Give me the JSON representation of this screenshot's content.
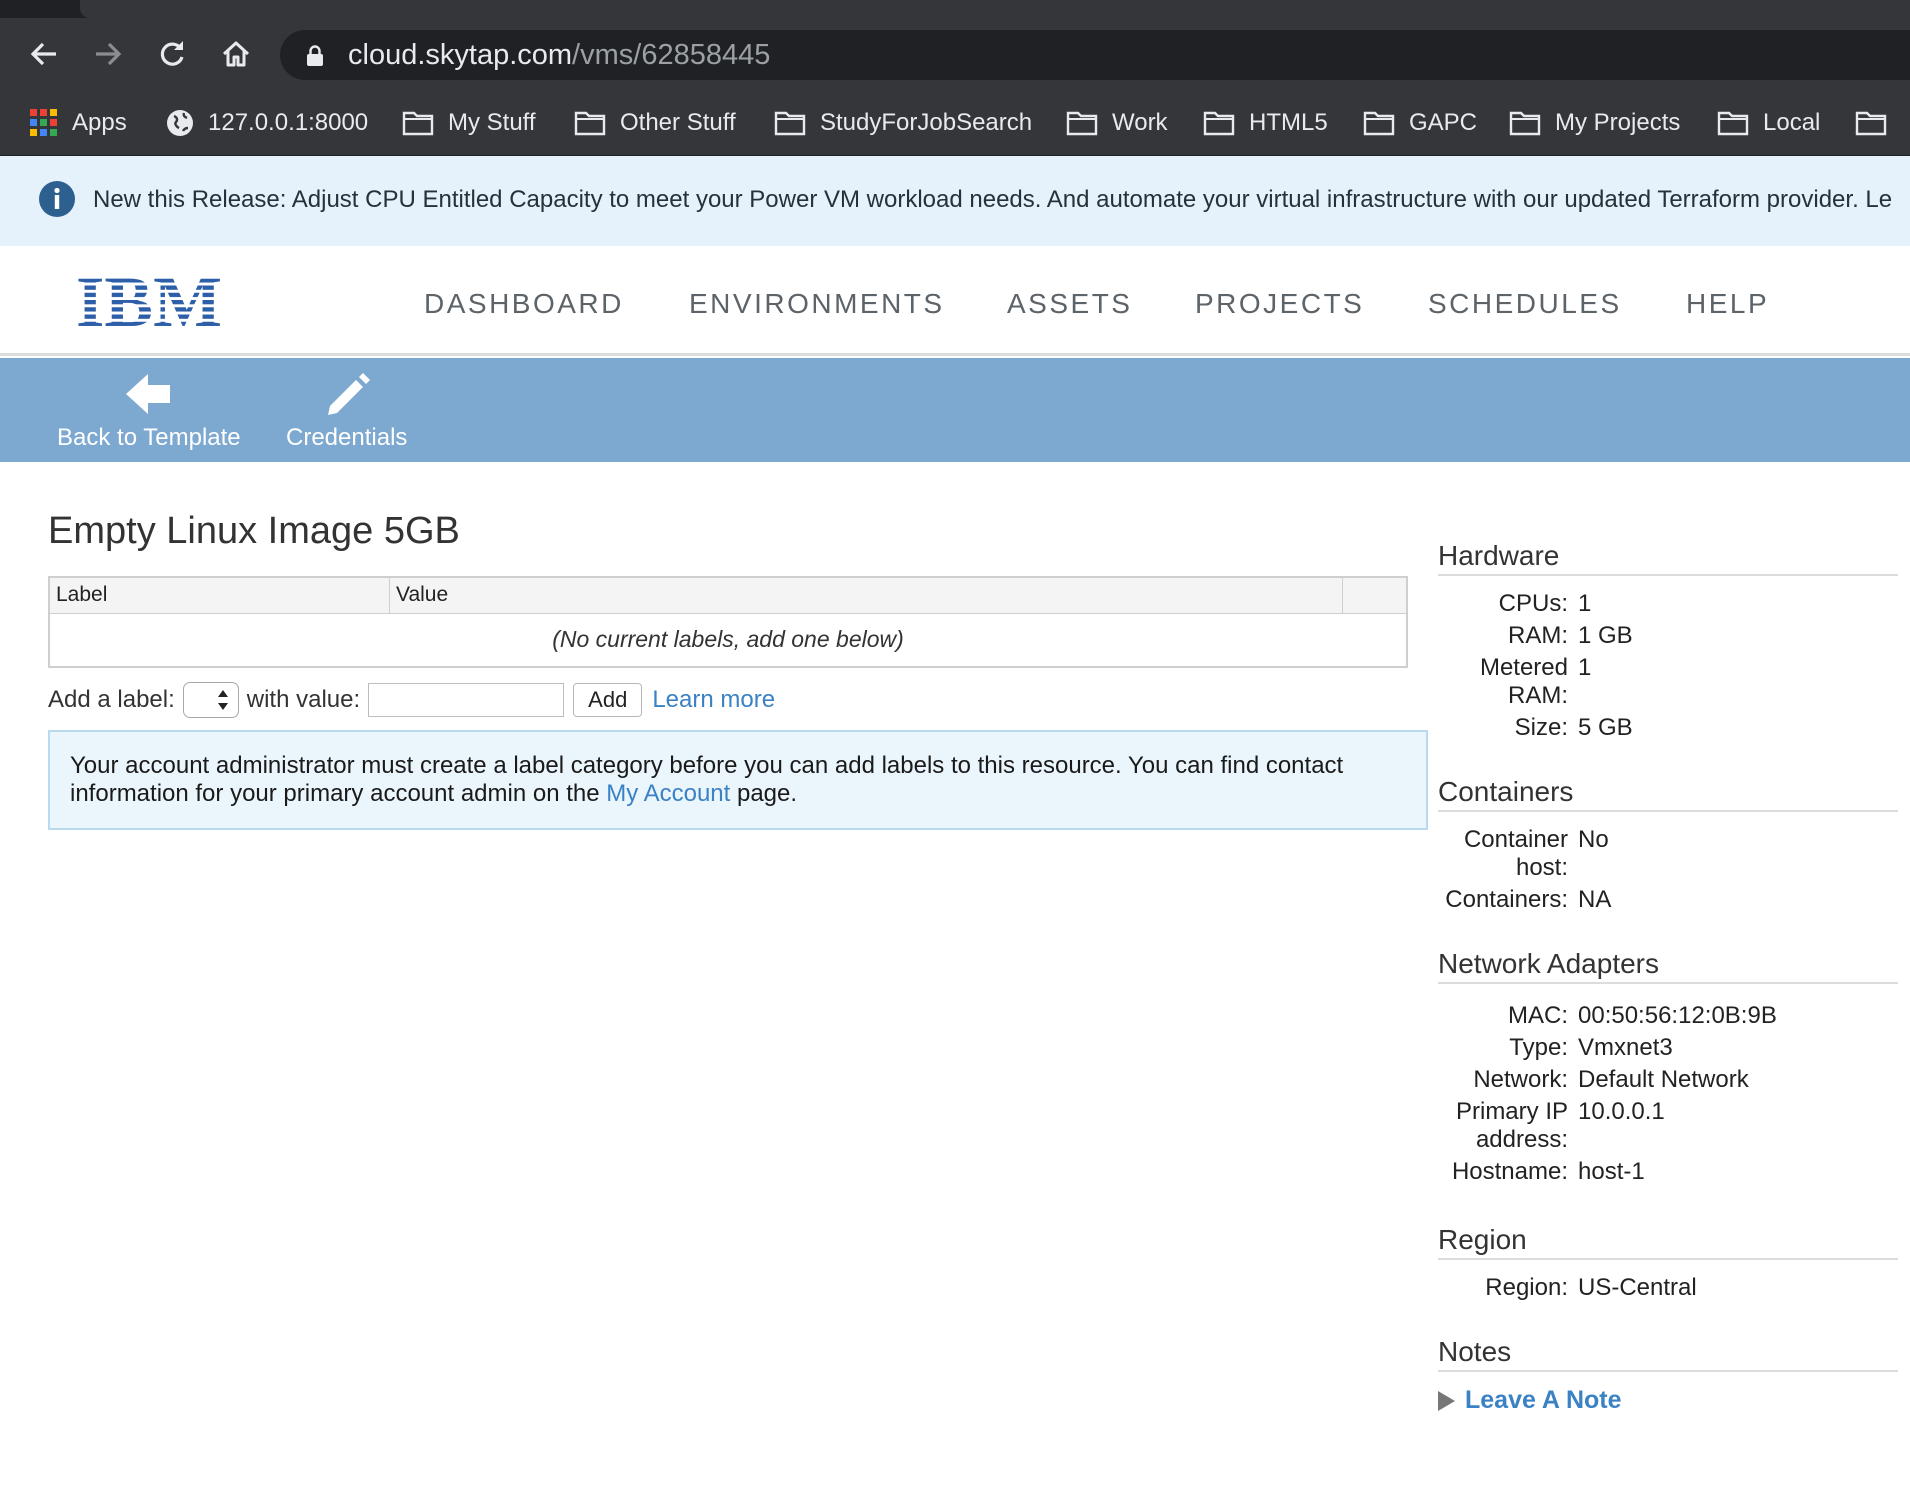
{
  "browser": {
    "url_host": "cloud.skytap.com",
    "url_path": "/vms/62858445",
    "bookmarks": [
      {
        "label": "Apps",
        "icon": "apps-grid-icon"
      },
      {
        "label": "127.0.0.1:8000",
        "icon": "globe-icon"
      },
      {
        "label": "My Stuff",
        "icon": "folder-icon"
      },
      {
        "label": "Other Stuff",
        "icon": "folder-icon"
      },
      {
        "label": "StudyForJobSearch",
        "icon": "folder-icon"
      },
      {
        "label": "Work",
        "icon": "folder-icon"
      },
      {
        "label": "HTML5",
        "icon": "folder-icon"
      },
      {
        "label": "GAPC",
        "icon": "folder-icon"
      },
      {
        "label": "My Projects",
        "icon": "folder-icon"
      },
      {
        "label": "Local",
        "icon": "folder-icon"
      }
    ]
  },
  "banner": {
    "text": "New this Release: Adjust CPU Entitled Capacity to meet your Power VM workload needs. And automate your virtual infrastructure with our updated Terraform provider. Le"
  },
  "header": {
    "logo": "IBM",
    "nav": [
      "DASHBOARD",
      "ENVIRONMENTS",
      "ASSETS",
      "PROJECTS",
      "SCHEDULES",
      "HELP"
    ]
  },
  "actions": {
    "back_label": "Back to Template",
    "credentials_label": "Credentials"
  },
  "main": {
    "title": "Empty Linux Image 5GB",
    "table": {
      "col_label": "Label",
      "col_value": "Value",
      "empty_text": "(No current labels, add one below)"
    },
    "add_label_text": "Add a label:",
    "with_value_text": "with value:",
    "add_button": "Add",
    "learn_more": "Learn more",
    "notice_before": "Your account administrator must create a label category before you can add labels to this resource. You can find contact information for your primary account admin on the ",
    "notice_link": "My Account",
    "notice_after": " page."
  },
  "sidebar": {
    "hardware": {
      "heading": "Hardware",
      "cpus_k": "CPUs:",
      "cpus_v": "1",
      "ram_k": "RAM:",
      "ram_v": "1 GB",
      "metered_k": "Metered RAM:",
      "metered_v": "1",
      "size_k": "Size:",
      "size_v": "5 GB"
    },
    "containers": {
      "heading": "Containers",
      "host_k": "Container host:",
      "host_v": "No",
      "containers_k": "Containers:",
      "containers_v": "NA"
    },
    "network": {
      "heading": "Network Adapters",
      "mac_k": "MAC:",
      "mac_v": "00:50:56:12:0B:9B",
      "type_k": "Type:",
      "type_v": "Vmxnet3",
      "network_k": "Network:",
      "network_v": "Default Network",
      "ip_k": "Primary IP address:",
      "ip_v": "10.0.0.1",
      "hostname_k": "Hostname:",
      "hostname_v": "host-1"
    },
    "region": {
      "heading": "Region",
      "region_k": "Region:",
      "region_v": "US-Central"
    },
    "notes": {
      "heading": "Notes",
      "leave_note": "Leave A Note"
    }
  },
  "colors": {
    "action_bar": "#7da9d1",
    "link": "#3a82c4",
    "ibm_blue": "#2c5fa8",
    "banner_bg": "#e6f2fb"
  }
}
